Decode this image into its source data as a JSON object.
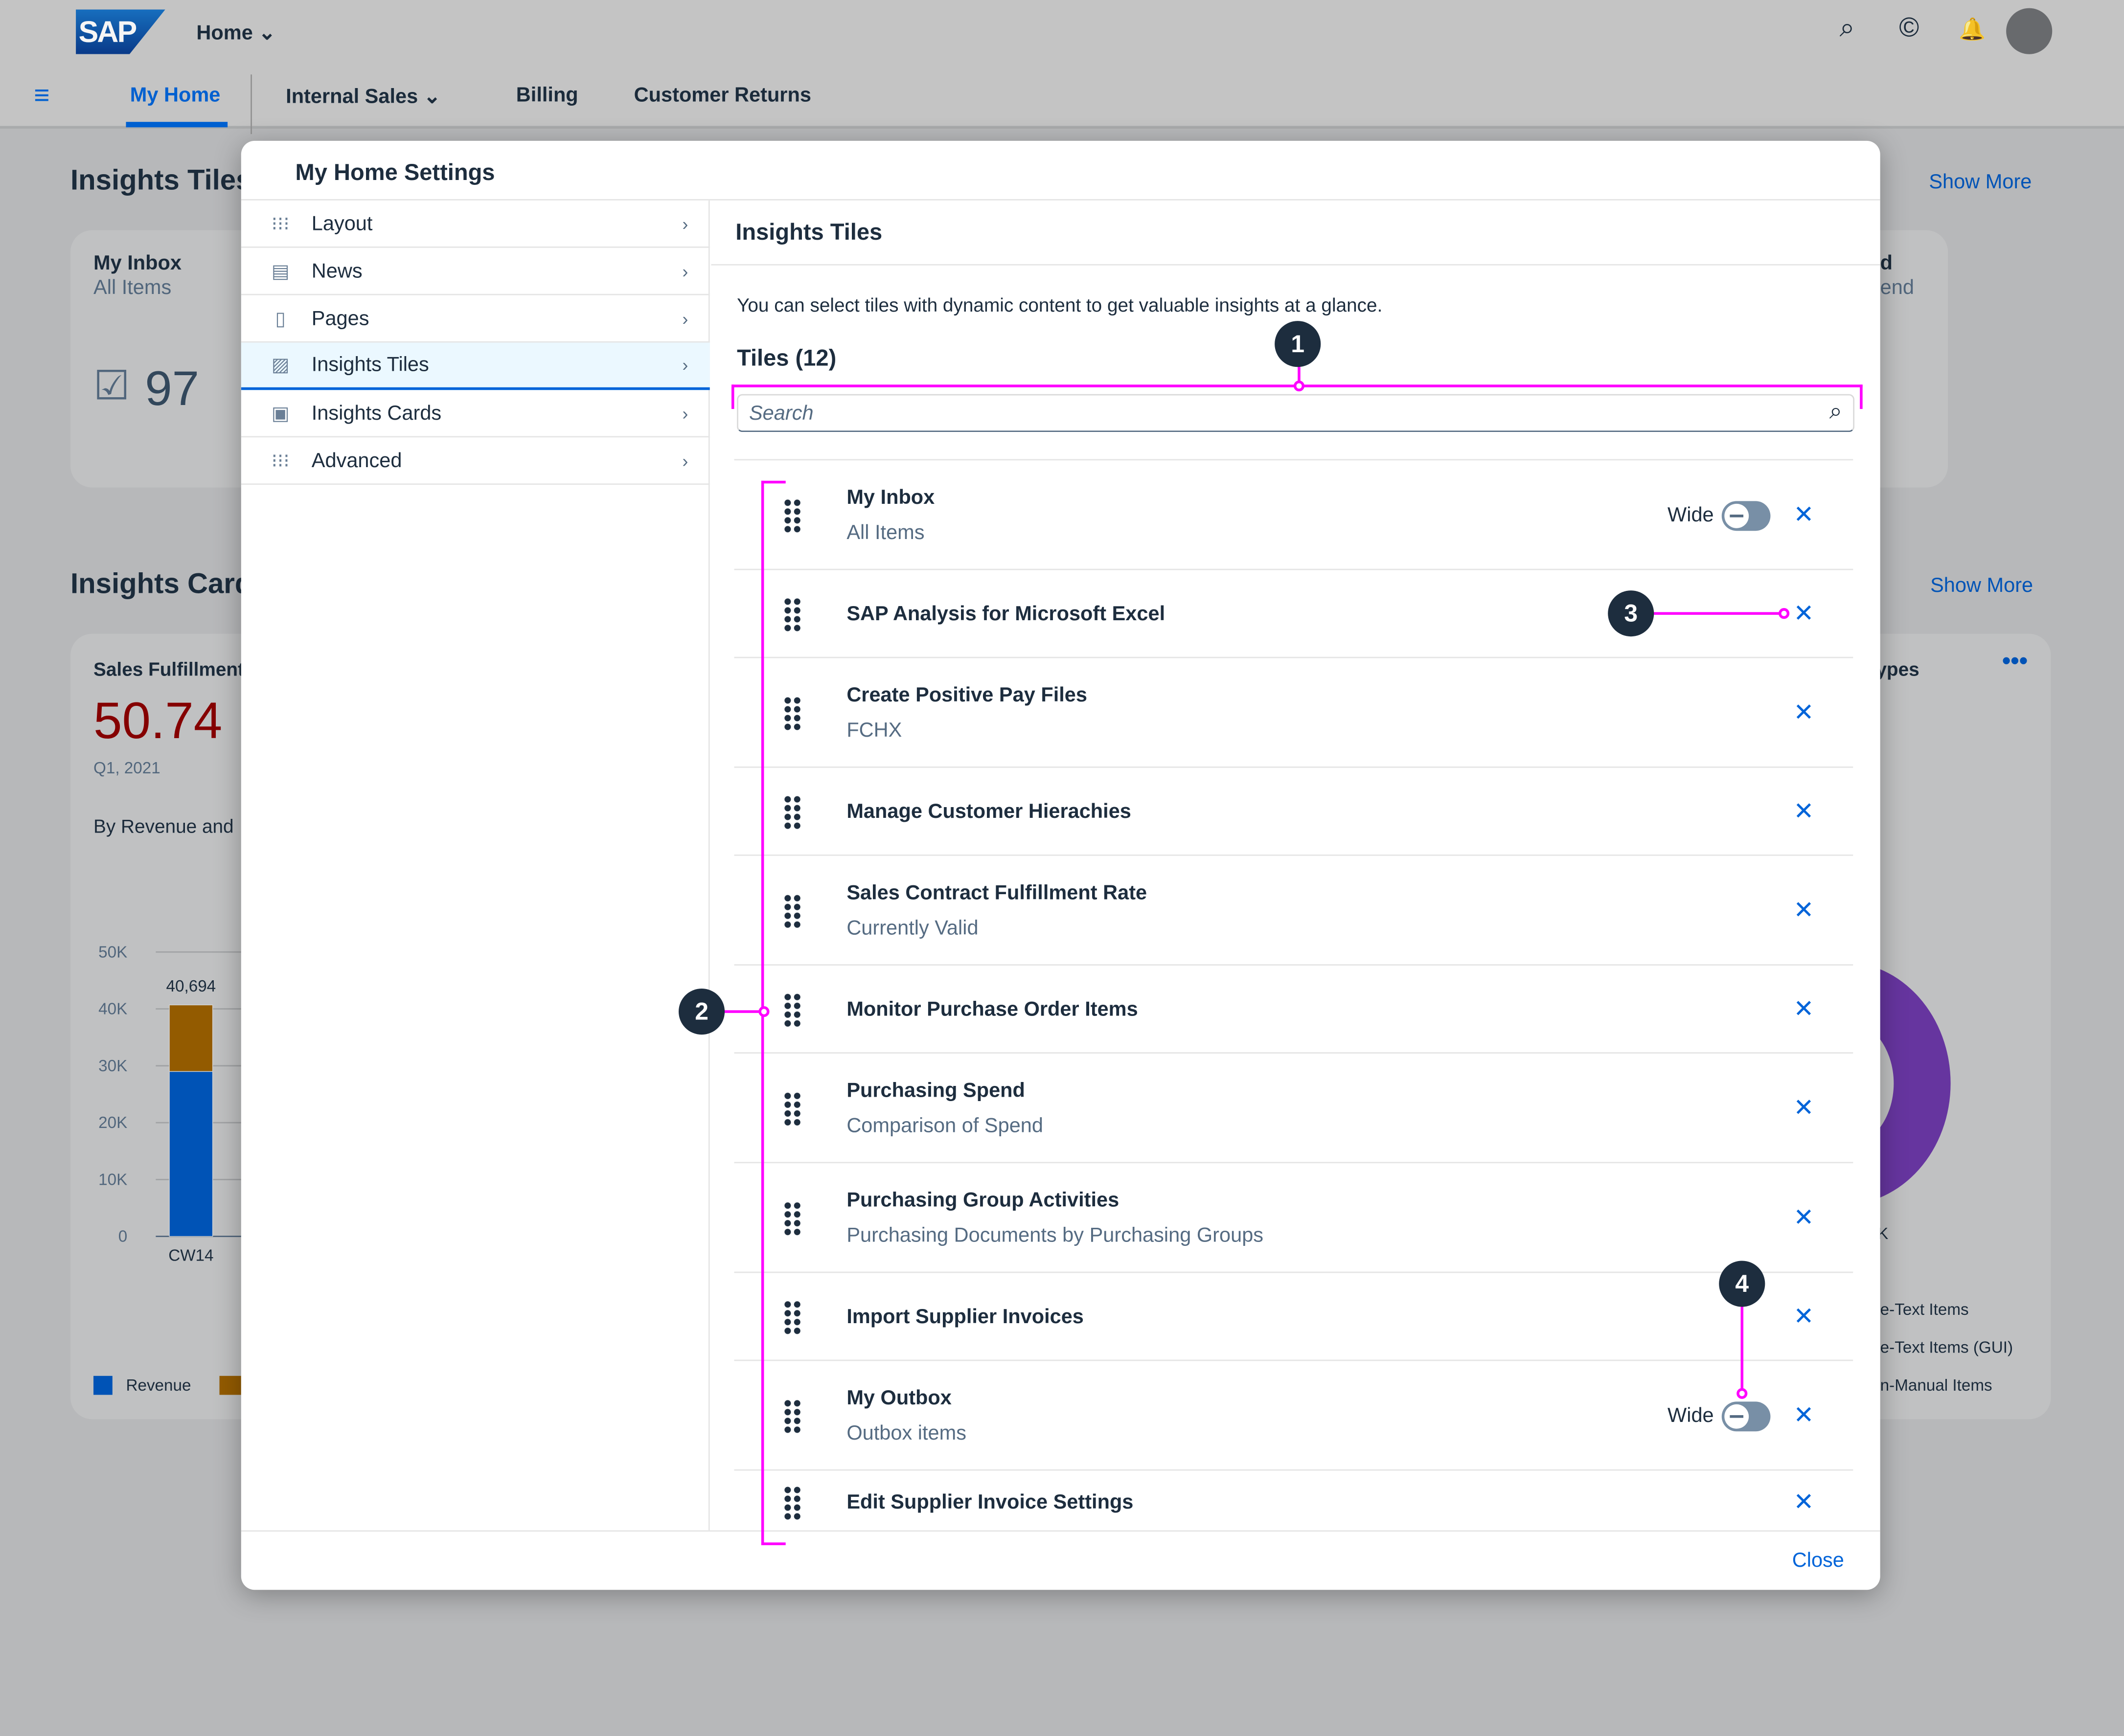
{
  "shell": {
    "logo": "SAP",
    "home_menu": "Home",
    "tabs": [
      "My Home",
      "Internal Sales",
      "Billing",
      "Customer Returns"
    ],
    "active_tab": "My Home"
  },
  "background": {
    "insights_tiles_title": "Insights Tiles",
    "show_more": "Show More",
    "inbox_title": "My Inbox",
    "inbox_sub": "All Items",
    "inbox_count": "97",
    "right_tile_title": "d",
    "right_tile_sub": "end",
    "insights_cards_title": "Insights Cards",
    "card1": {
      "title": "Sales Fulfillment",
      "kpi": "50.74",
      "period": "Q1, 2021",
      "subtitle": "By Revenue and",
      "legend": [
        "Revenue"
      ]
    },
    "card2": {
      "title_frag": "ypes",
      "legend": [
        "e-Text Items",
        "e-Text Items (GUI)",
        "n-Manual Items"
      ],
      "axis_frag": "K"
    }
  },
  "chart_data": {
    "type": "bar",
    "stacked": true,
    "categories": [
      "CW14"
    ],
    "series": [
      {
        "name": "Revenue",
        "values": [
          29000
        ],
        "color": "#0057be"
      },
      {
        "values": [
          11694
        ],
        "color": "#9a5f00"
      }
    ],
    "totals": [
      "40,694"
    ],
    "yticks": [
      "0",
      "10K",
      "20K",
      "30K",
      "40K",
      "50K"
    ],
    "ylim": [
      0,
      50000
    ]
  },
  "dialog": {
    "title": "My Home Settings",
    "nav": [
      {
        "label": "Layout",
        "icon": "grid-icon"
      },
      {
        "label": "News",
        "icon": "news-icon"
      },
      {
        "label": "Pages",
        "icon": "pages-icon"
      },
      {
        "label": "Insights Tiles",
        "icon": "tiles-icon",
        "selected": true
      },
      {
        "label": "Insights Cards",
        "icon": "cards-icon"
      },
      {
        "label": "Advanced",
        "icon": "grid-icon"
      }
    ],
    "panel_title": "Insights Tiles",
    "description": "You can select tiles with dynamic content to get valuable insights at a glance.",
    "tiles_header": "Tiles (12)",
    "search_placeholder": "Search",
    "wide_label": "Wide",
    "tiles": [
      {
        "title": "My Inbox",
        "subtitle": "All Items",
        "wide": false
      },
      {
        "title": "SAP Analysis for Microsoft Excel"
      },
      {
        "title": "Create Positive Pay Files",
        "subtitle": "FCHX"
      },
      {
        "title": "Manage Customer Hierachies"
      },
      {
        "title": "Sales Contract Fulfillment Rate",
        "subtitle": "Currently Valid"
      },
      {
        "title": "Monitor Purchase Order Items"
      },
      {
        "title": "Purchasing Spend",
        "subtitle": "Comparison of Spend"
      },
      {
        "title": "Purchasing Group Activities",
        "subtitle": "Purchasing Documents by Purchasing Groups"
      },
      {
        "title": "Import Supplier Invoices"
      },
      {
        "title": "My Outbox",
        "subtitle": "Outbox items",
        "wide": false
      },
      {
        "title": "Edit Supplier Invoice Settings"
      }
    ],
    "close": "Close"
  },
  "annotations": [
    "1",
    "2",
    "3",
    "4"
  ],
  "colors": {
    "accent": "#0064d9",
    "annotation": "#ff00ff",
    "kpi": "#8b0000"
  }
}
